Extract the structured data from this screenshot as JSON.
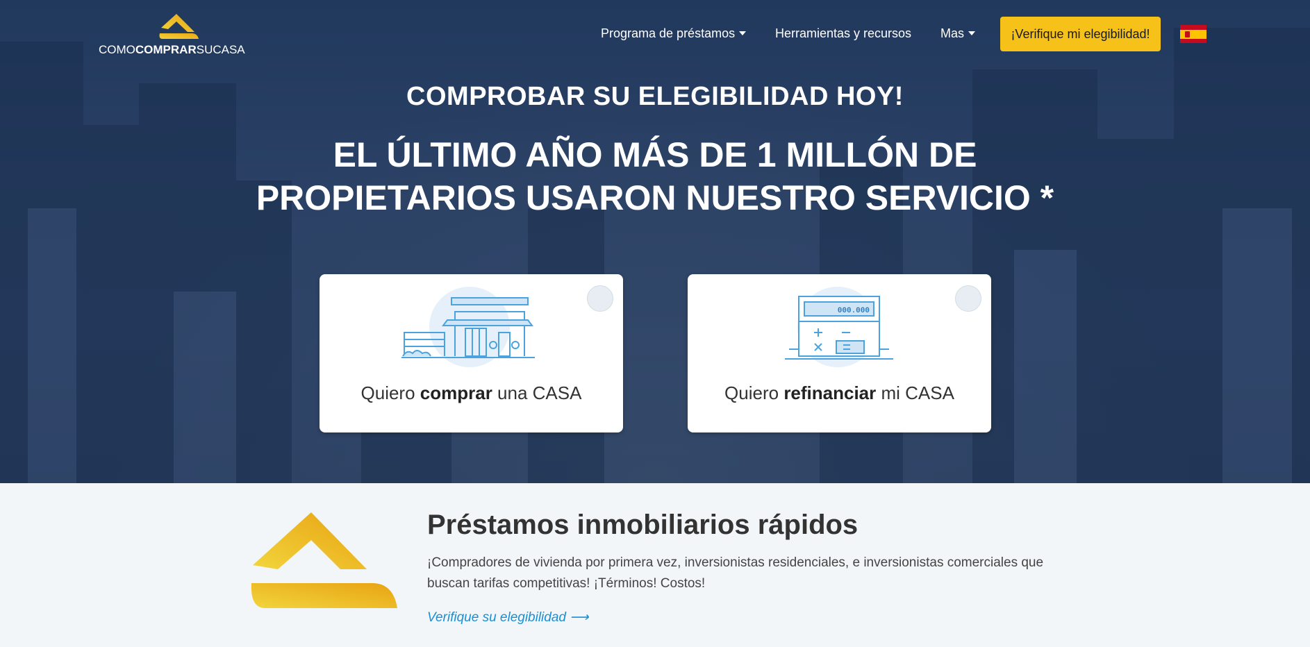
{
  "brand": {
    "logo_part1": "COMO",
    "logo_part2": "COMPRAR",
    "logo_part3": "SUCASA",
    "accent_color": "#f6c21a"
  },
  "nav": {
    "items": [
      {
        "label": "Programa de préstamos",
        "dropdown": true
      },
      {
        "label": "Herramientas y recursos",
        "dropdown": false
      },
      {
        "label": "Mas",
        "dropdown": true
      }
    ],
    "cta_label": "¡Verifique mi elegibilidad!",
    "language_icon": "spain-flag-icon"
  },
  "hero": {
    "eyebrow": "COMPROBAR SU ELEGIBILIDAD HOY!",
    "headline_line1": "EL ÚLTIMO AÑO MÁS DE 1 MILLÓN DE",
    "headline_line2": "PROPIETARIOS USARON NUESTRO SERVICIO *"
  },
  "options": [
    {
      "prefix": "Quiero ",
      "bold": "comprar",
      "suffix": " una CASA",
      "icon": "house-icon"
    },
    {
      "prefix": "Quiero ",
      "bold": "refinanciar",
      "suffix": " mi CASA",
      "icon": "calculator-icon",
      "calc_display": "000.000"
    }
  ],
  "feature": {
    "title": "Préstamos inmobiliarios rápidos",
    "text": "¡Compradores de vivienda por primera vez, inversionistas residenciales, e inversionistas comerciales que buscan tarifas competitivas! ¡Términos! Costos!",
    "link": "Verifique su elegibilidad ⟶"
  }
}
